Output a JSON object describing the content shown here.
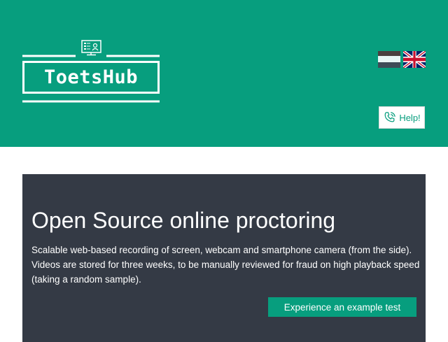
{
  "brand": {
    "name": "ToetsHub"
  },
  "languages": [
    {
      "name": "Nederlands",
      "icon": "flag-nl-icon"
    },
    {
      "name": "English",
      "icon": "flag-uk-icon"
    }
  ],
  "help": {
    "label": "Help!",
    "icon": "phone-icon"
  },
  "hero": {
    "title": "Open Source online proctoring",
    "description": "Scalable web-based recording of screen, webcam and smartphone camera (from the side). Videos are stored for three weeks, to be manually reviewed for fraud on high playback speed (taking a random sample).",
    "cta_label": "Experience an example test"
  },
  "colors": {
    "brand_green": "#079e7e",
    "hero_bg": "#343a45",
    "white": "#ffffff"
  }
}
